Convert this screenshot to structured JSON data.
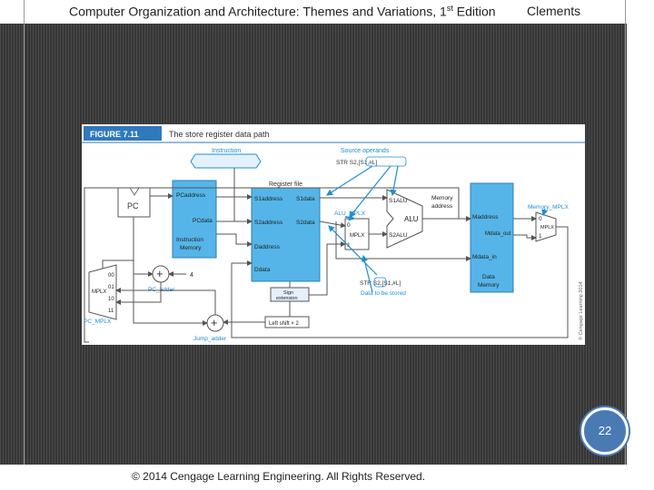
{
  "header": {
    "title": "Computer Organization and Architecture: Themes and Variations, 1",
    "title_sup": "st",
    "title_end": " Edition",
    "author": "Clements"
  },
  "figure": {
    "number": "FIGURE 7.11",
    "caption": "The store register data path",
    "instruction_label": "Instruction",
    "source_operands_label": "Source operands",
    "source_operands_code": "STR  S2,[S1,#L]",
    "register_file_label": "Register file",
    "pc_label": "PC",
    "pc_address": "PCaddress",
    "pc_data": "PCdata",
    "instr_mem": [
      "Instruction",
      "Memory"
    ],
    "s1_address": "S1address",
    "s1_data": "S1data",
    "s2_address": "S2address",
    "s2_data": "S2data",
    "d_address": "Daddress",
    "d_data": "Ddata",
    "alu_mplx": "ALU_MPLX",
    "mplx": "MPLX",
    "alu": "ALU",
    "s1_alu": "S1ALU",
    "s2_alu": "S2ALU",
    "memory_address_label": [
      "Memory",
      "address"
    ],
    "m_address": "Maddress",
    "m_data_out": "Mdata_out",
    "m_data_in": "Mdata_in",
    "data_memory": [
      "Data",
      "Memory"
    ],
    "memory_mplx": "Memory_MPLX",
    "pc_adder": "PC_adder",
    "pc_mplx": "PC_MPLX",
    "jump_adder": "Jump_adder",
    "sign_extension": [
      "Sign",
      "extension"
    ],
    "left_shift": "Left shift × 2",
    "constant_4": "4",
    "plus": "+",
    "str_code": "STR  S2,[S1,#L]",
    "data_to_be_stored": "Data to be stored",
    "pc_mplx_inputs": [
      "00",
      "01",
      "10",
      "11"
    ],
    "mux_0": "0",
    "mux_1": "1",
    "copyright_side": "© Cengage Learning 2014"
  },
  "footer": {
    "copyright": "© 2014 Cengage Learning Engineering. All Rights Reserved."
  },
  "page_number": "22",
  "colors": {
    "figure_title_bg": "#2f79bd",
    "component_blue": "#55b5e8",
    "label_blue": "#2a8fd0",
    "callout_fill": "#e4f1fa",
    "page_badge": "#4a7ab4"
  }
}
